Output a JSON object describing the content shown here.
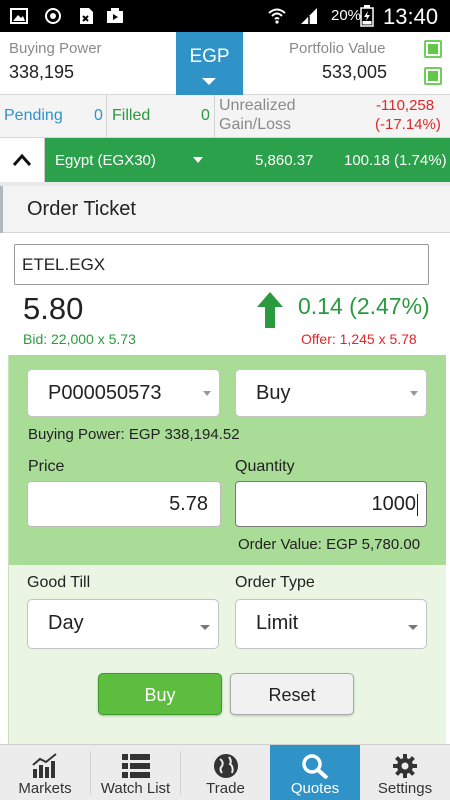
{
  "status_bar": {
    "battery_percent": "20%",
    "time": "13:40"
  },
  "account": {
    "buying_power_label": "Buying Power",
    "buying_power_value": "338,195",
    "currency": "EGP",
    "portfolio_label": "Portfolio Value",
    "portfolio_value": "533,005"
  },
  "orders": {
    "pending_label": "Pending",
    "pending_count": "0",
    "filled_label": "Filled",
    "filled_count": "0",
    "unrealized_label_1": "Unrealized",
    "unrealized_label_2": "Gain/Loss",
    "unrealized_value": "-110,258",
    "unrealized_percent": "(-17.14%)"
  },
  "market": {
    "name": "Egypt (EGX30)",
    "value": "5,860.37",
    "change": "100.18 (1.74%)"
  },
  "ticket": {
    "title": "Order Ticket",
    "symbol": "ETEL.EGX",
    "last_price": "5.80",
    "bid": "Bid: 22,000  x  5.73",
    "change": "0.14 (2.47%)",
    "offer": "Offer: 1,245  x  5.78",
    "account_id": "P000050573",
    "side": "Buy",
    "buying_power_text": "Buying Power: EGP 338,194.52",
    "price_label": "Price",
    "price_value": "5.78",
    "quantity_label": "Quantity",
    "quantity_value": "1000",
    "order_value_text": "Order Value: EGP 5,780.00",
    "good_till_label": "Good Till",
    "good_till_value": "Day",
    "order_type_label": "Order Type",
    "order_type_value": "Limit",
    "buy_button": "Buy",
    "reset_button": "Reset"
  },
  "colors": {
    "accent_blue": "#2f93c8",
    "positive_green": "#2a9a3f",
    "negative_red": "#e02727",
    "market_green": "#2aa14a"
  },
  "nav": [
    {
      "label": "Markets",
      "icon": "bar-chart-icon"
    },
    {
      "label": "Watch List",
      "icon": "list-icon"
    },
    {
      "label": "Trade",
      "icon": "globe-icon"
    },
    {
      "label": "Quotes",
      "icon": "magnifier-icon"
    },
    {
      "label": "Settings",
      "icon": "gear-icon"
    }
  ]
}
